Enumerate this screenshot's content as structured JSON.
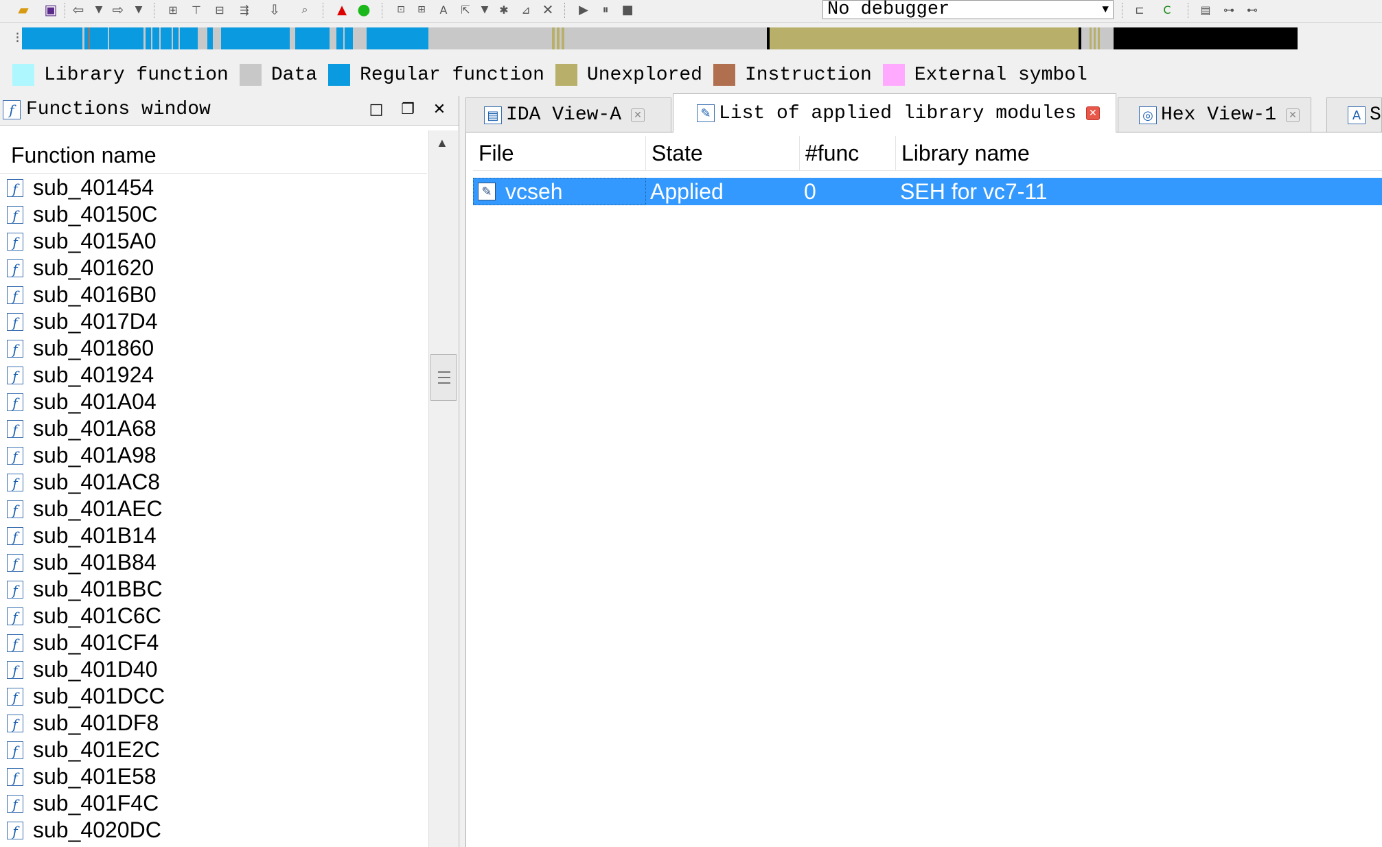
{
  "toolbar": {
    "debugger_select": "No debugger",
    "icons": [
      "open-icon",
      "save-icon",
      "back-icon",
      "back-dropdown-icon",
      "forward-icon",
      "forward-dropdown-icon",
      "hex-icon",
      "text-icon",
      "binary-icon",
      "jump-icon",
      "down-arrow-icon",
      "search-icon",
      "warning-icon",
      "run-green-icon",
      "code-icon",
      "data-icon",
      "string-icon",
      "xref-icon",
      "xref-dropdown-icon",
      "struct-icon",
      "patch-icon",
      "close-cross-icon",
      "play-icon",
      "pause-icon",
      "stop-icon",
      "debugger-dropdown-icon",
      "copy-icon",
      "decompile-icon",
      "bookmark-icon",
      "graph-icon",
      "graph-add-icon"
    ]
  },
  "navband_colors": {
    "regular": "#0a9ae0",
    "gap": "#c8c8c8",
    "unexplored": "#b8b06a",
    "instruction": "#b07050",
    "black": "#000000"
  },
  "legend": [
    {
      "label": "Library function",
      "color": "#aef7ff"
    },
    {
      "label": "Data",
      "color": "#c8c8c8"
    },
    {
      "label": "Regular function",
      "color": "#0a9ae0"
    },
    {
      "label": "Unexplored",
      "color": "#b8b06a"
    },
    {
      "label": "Instruction",
      "color": "#b07050"
    },
    {
      "label": "External symbol",
      "color": "#ffaaff"
    }
  ],
  "functions_window": {
    "title": "Functions window",
    "column_header": "Function name",
    "functions": [
      "sub_401454",
      "sub_40150C",
      "sub_4015A0",
      "sub_401620",
      "sub_4016B0",
      "sub_4017D4",
      "sub_401860",
      "sub_401924",
      "sub_401A04",
      "sub_401A68",
      "sub_401A98",
      "sub_401AC8",
      "sub_401AEC",
      "sub_401B14",
      "sub_401B84",
      "sub_401BBC",
      "sub_401C6C",
      "sub_401CF4",
      "sub_401D40",
      "sub_401DCC",
      "sub_401DF8",
      "sub_401E2C",
      "sub_401E58",
      "sub_401F4C",
      "sub_4020DC"
    ]
  },
  "tabs": [
    {
      "label": "IDA View-A",
      "icon": "ida-view-icon",
      "active": false
    },
    {
      "label": "List of applied library modules",
      "icon": "library-list-icon",
      "active": true
    },
    {
      "label": "Hex View-1",
      "icon": "hex-view-icon",
      "active": false
    },
    {
      "label": "S",
      "icon": "strings-icon",
      "active": false
    }
  ],
  "library_table": {
    "columns": [
      "File",
      "State",
      "#func",
      "Library name"
    ],
    "rows": [
      {
        "file": "vcseh",
        "state": "Applied",
        "func": "0",
        "library": "SEH for vc7-11",
        "selected": true
      }
    ]
  }
}
